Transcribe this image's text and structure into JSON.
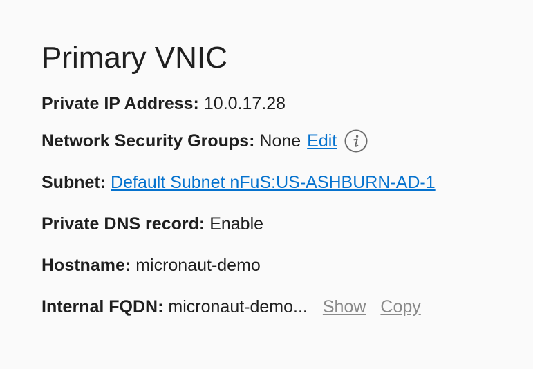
{
  "section": {
    "title": "Primary VNIC"
  },
  "fields": {
    "private_ip": {
      "label": "Private IP Address:",
      "value": "10.0.17.28"
    },
    "nsg": {
      "label": "Network Security Groups:",
      "value": "None",
      "edit_label": "Edit",
      "info_icon": "info-icon"
    },
    "subnet": {
      "label": "Subnet:",
      "link_text": "Default Subnet nFuS:US-ASHBURN-AD-1"
    },
    "dns": {
      "label": "Private DNS record:",
      "value": "Enable"
    },
    "hostname": {
      "label": "Hostname:",
      "value": "micronaut-demo"
    },
    "fqdn": {
      "label": "Internal FQDN:",
      "value": "micronaut-demo...",
      "show_label": "Show",
      "copy_label": "Copy"
    }
  },
  "colors": {
    "link": "#0572ce",
    "muted_link": "#8a8a8a",
    "text": "#1f1f1f",
    "background": "#fafafa"
  }
}
